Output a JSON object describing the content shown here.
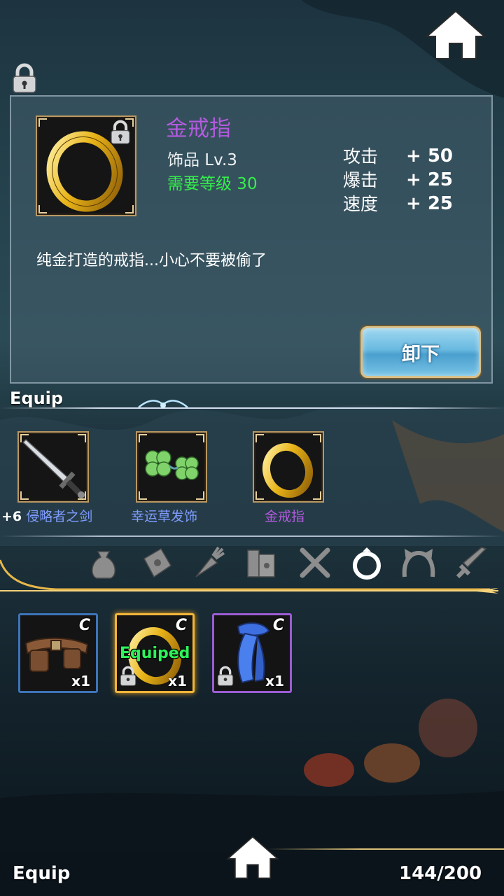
{
  "item": {
    "name": "金戒指",
    "type_level": "饰品 Lv.3",
    "requirement": "需要等级 30",
    "description": "纯金打造的戒指...小心不要被偷了",
    "stats": [
      {
        "label": "攻击",
        "value": "+ 50"
      },
      {
        "label": "爆击",
        "value": "+ 25"
      },
      {
        "label": "速度",
        "value": "+ 25"
      }
    ],
    "unequip_label": "卸下"
  },
  "equip_section": {
    "title": "Equip",
    "slots": [
      {
        "prefix": "+6",
        "name": "侵略者之剑",
        "color": "#7f9cff"
      },
      {
        "prefix": "",
        "name": "幸运草发饰",
        "color": "#7f9cff"
      },
      {
        "prefix": "",
        "name": "金戒指",
        "color": "#b45ae0"
      }
    ]
  },
  "categories": [
    "bag-icon",
    "scroll-icon",
    "carrot-icon",
    "books-icon",
    "fork-knife-icon",
    "ring-icon",
    "cat-ears-icon",
    "sword-icon"
  ],
  "inventory": [
    {
      "name": "belt",
      "rarity": "C",
      "qty": "x1",
      "border": "#3d74b8",
      "locked": false,
      "equipped": ""
    },
    {
      "name": "gold-ring",
      "rarity": "C",
      "qty": "x1",
      "border": "#f0b53a",
      "locked": true,
      "equipped": "Equiped"
    },
    {
      "name": "blue-scarf",
      "rarity": "C",
      "qty": "x1",
      "border": "#9b5cd4",
      "locked": true,
      "equipped": ""
    }
  ],
  "footer": {
    "title": "Equip",
    "capacity": "144/200"
  }
}
